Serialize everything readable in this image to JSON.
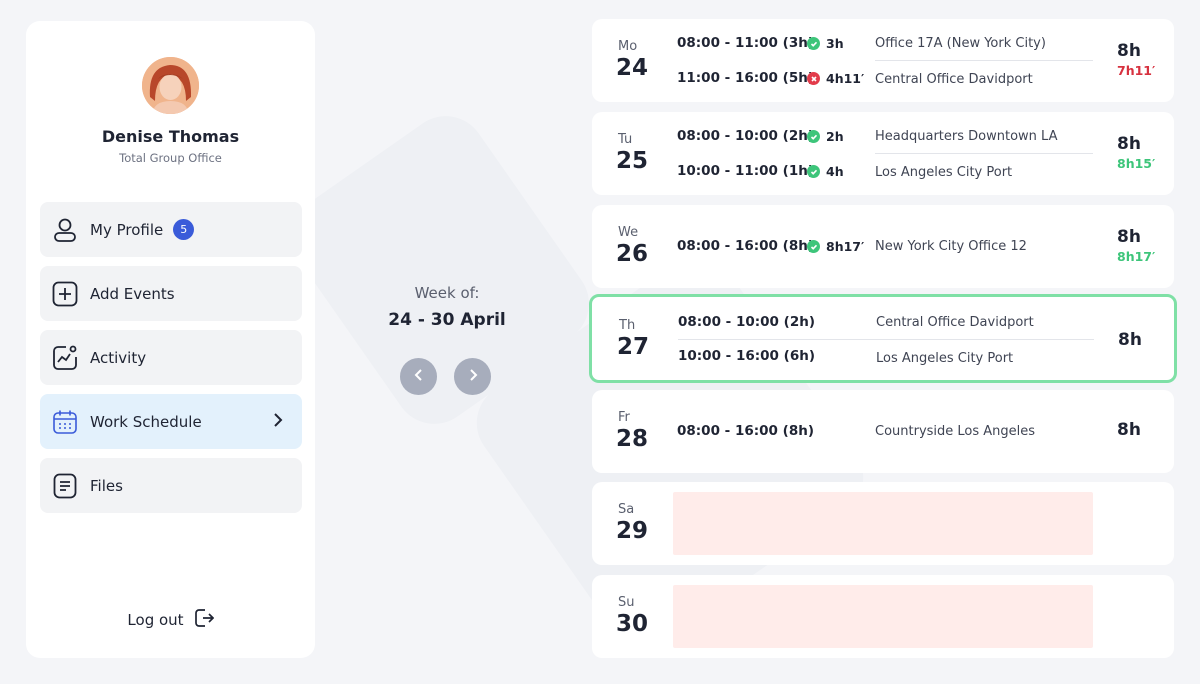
{
  "user": {
    "name": "Denise Thomas",
    "subtitle": "Total Group Office"
  },
  "nav": {
    "my_profile": "My Profile",
    "my_profile_badge": "5",
    "add_events": "Add Events",
    "activity": "Activity",
    "work_schedule": "Work Schedule",
    "files": "Files",
    "logout": "Log out"
  },
  "week": {
    "label": "Week of:",
    "range": "24 - 30 April"
  },
  "colors": {
    "accent_blue": "#3a5bd9",
    "ok_green": "#3dc57a",
    "error_red": "#d7313f",
    "highlight_border": "#7fe0a6",
    "active_nav": "#e3f1fc",
    "empty_day": "#ffecea"
  },
  "days": {
    "mo": {
      "name": "Mo",
      "num": "24",
      "total": "8h",
      "diff": "7h11′",
      "shifts": [
        {
          "time": "08:00 - 11:00 (3h)",
          "status": "3h",
          "status_type": "ok",
          "location": "Office 17A (New York City)"
        },
        {
          "time": "11:00 - 16:00 (5h)",
          "status": "4h11′",
          "status_type": "bad",
          "location": "Central Office Davidport"
        }
      ]
    },
    "tu": {
      "name": "Tu",
      "num": "25",
      "total": "8h",
      "diff": "8h15′",
      "shifts": [
        {
          "time": "08:00 - 10:00 (2h)",
          "status": "2h",
          "status_type": "ok",
          "location": "Headquarters Downtown LA"
        },
        {
          "time": "10:00 - 11:00 (1h)",
          "status": "4h",
          "status_type": "ok",
          "location": "Los Angeles City Port"
        }
      ]
    },
    "we": {
      "name": "We",
      "num": "26",
      "total": "8h",
      "diff": "8h17′",
      "shifts": [
        {
          "time": "08:00 - 16:00 (8h)",
          "status": "8h17′",
          "status_type": "ok",
          "location": "New York City Office 12"
        }
      ]
    },
    "th": {
      "name": "Th",
      "num": "27",
      "total": "8h",
      "shifts": [
        {
          "time": "08:00 - 10:00 (2h)",
          "location": "Central Office Davidport"
        },
        {
          "time": "10:00 - 16:00 (6h)",
          "location": "Los Angeles City Port"
        }
      ]
    },
    "fr": {
      "name": "Fr",
      "num": "28",
      "total": "8h",
      "shifts": [
        {
          "time": "08:00 - 16:00 (8h)",
          "location": "Countryside Los Angeles"
        }
      ]
    },
    "sa": {
      "name": "Sa",
      "num": "29"
    },
    "su": {
      "name": "Su",
      "num": "30"
    }
  }
}
